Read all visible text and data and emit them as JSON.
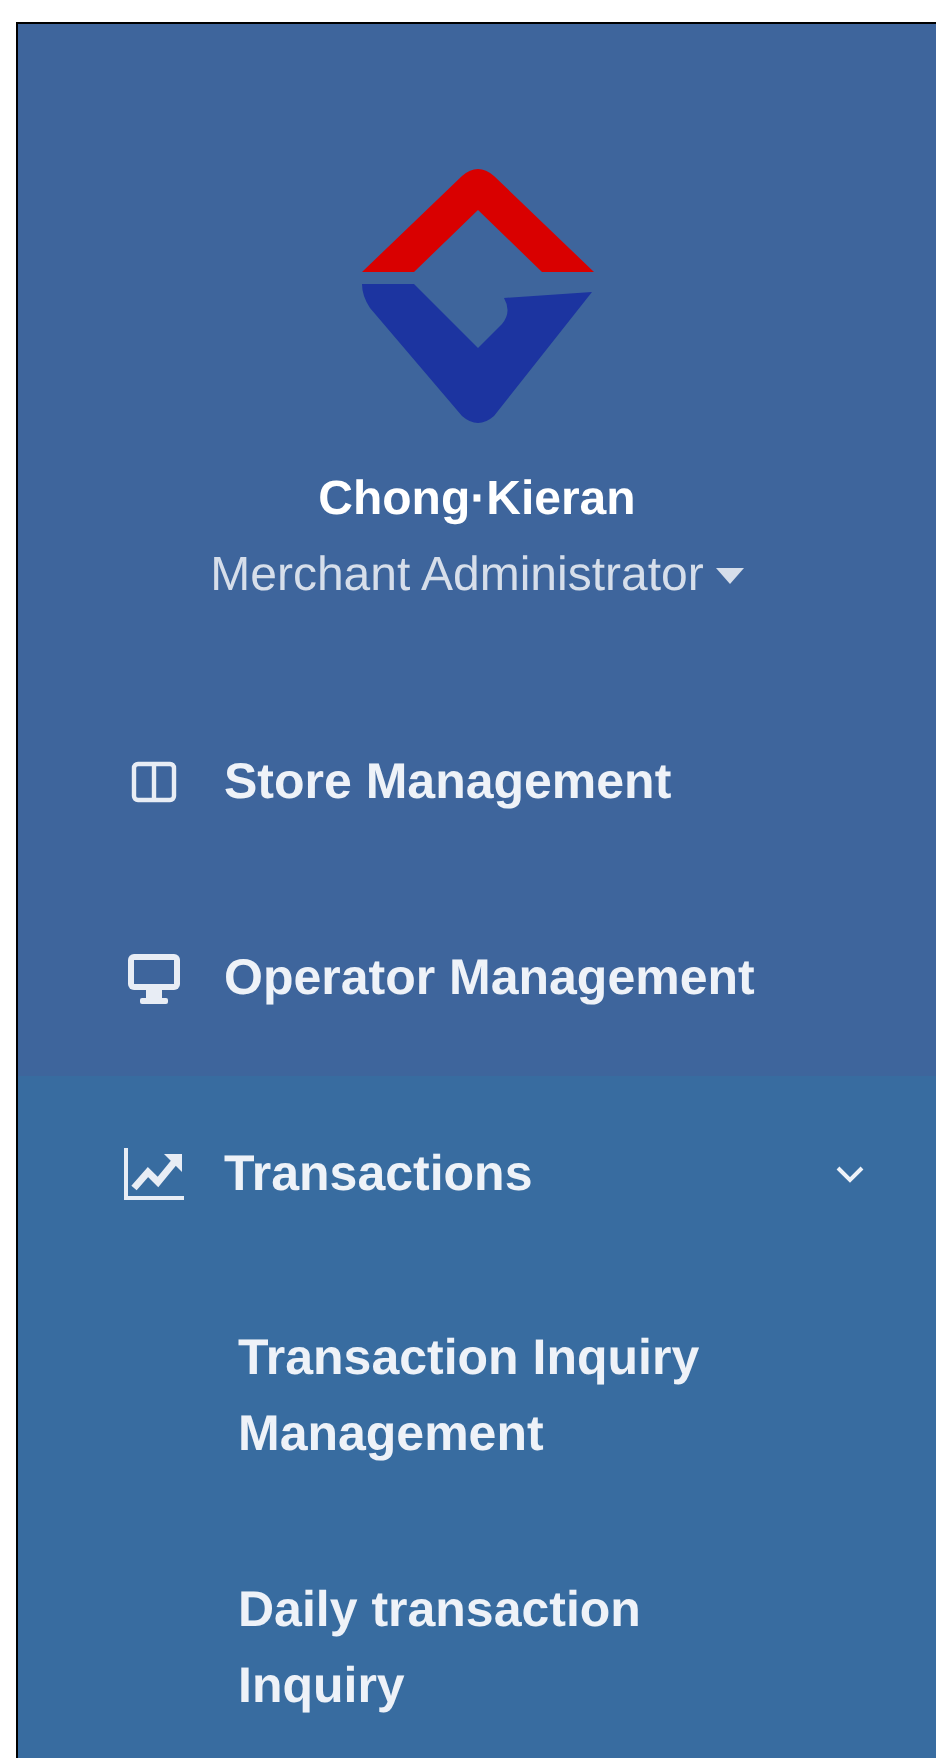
{
  "user": {
    "name": "Chong·Kieran",
    "role": "Merchant Administrator"
  },
  "menu": [
    {
      "label": "Store Management",
      "expanded": false
    },
    {
      "label": "Operator Management",
      "expanded": false
    },
    {
      "label": "Transactions",
      "expanded": true,
      "children": [
        {
          "label": "Transaction Inquiry Management"
        },
        {
          "label": "Daily transaction Inquiry"
        }
      ]
    }
  ]
}
